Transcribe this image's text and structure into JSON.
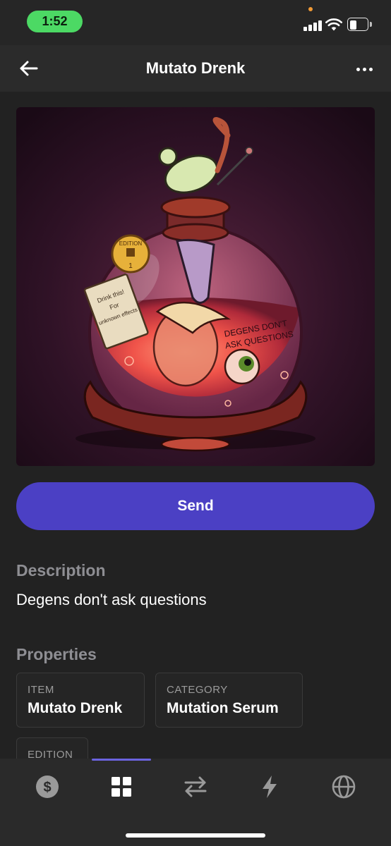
{
  "status_bar": {
    "time": "1:52"
  },
  "header": {
    "title": "Mutato Drenk",
    "back_icon": "arrow-left-icon",
    "more_icon": "more-horizontal-icon"
  },
  "artwork": {
    "tag_text_line1": "Drink this!",
    "tag_text_line2": "For",
    "tag_text_line3": "unknown effects",
    "coin_text": "EDITION",
    "coin_number": "1",
    "bottle_text_line1": "DEGENS DON'T",
    "bottle_text_line2": "ASK QUESTIONS"
  },
  "actions": {
    "send_label": "Send"
  },
  "description": {
    "heading": "Description",
    "text": "Degens don't ask questions"
  },
  "properties": {
    "heading": "Properties",
    "items": [
      {
        "label": "ITEM",
        "value": "Mutato Drenk"
      },
      {
        "label": "CATEGORY",
        "value": "Mutation Serum"
      },
      {
        "label": "EDITION",
        "value": ""
      }
    ]
  },
  "tabs": [
    {
      "icon": "dollar-icon",
      "active": false
    },
    {
      "icon": "grid-icon",
      "active": true
    },
    {
      "icon": "swap-icon",
      "active": false
    },
    {
      "icon": "lightning-icon",
      "active": false
    },
    {
      "icon": "globe-icon",
      "active": false
    }
  ],
  "colors": {
    "background": "#222222",
    "accent": "#4b40c4",
    "muted_text": "#8e8e93",
    "status_green": "#4cd964"
  }
}
